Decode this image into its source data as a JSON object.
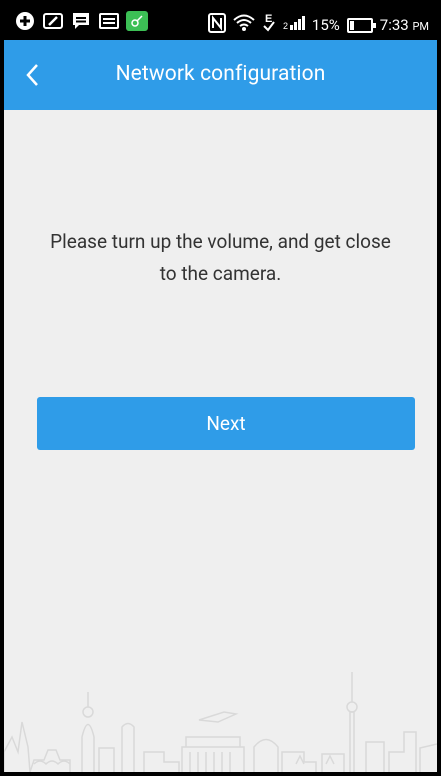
{
  "status_bar": {
    "battery_percent": "15%",
    "time": "7:33",
    "time_suffix": "PM",
    "icons": [
      "add-icon",
      "edit-icon",
      "message-icon",
      "keyboard-icon",
      "app-icon",
      "nfc-icon",
      "wifi-icon",
      "data-icon",
      "signal-icon",
      "battery-icon"
    ]
  },
  "app_bar": {
    "title": "Network configuration",
    "back_icon": "chevron-left-icon"
  },
  "main": {
    "instruction": "Please turn up the volume, and get close to the camera.",
    "next_label": "Next"
  },
  "colors": {
    "accent": "#2f9ce8",
    "background": "#efefef",
    "status_bar": "#000000"
  }
}
